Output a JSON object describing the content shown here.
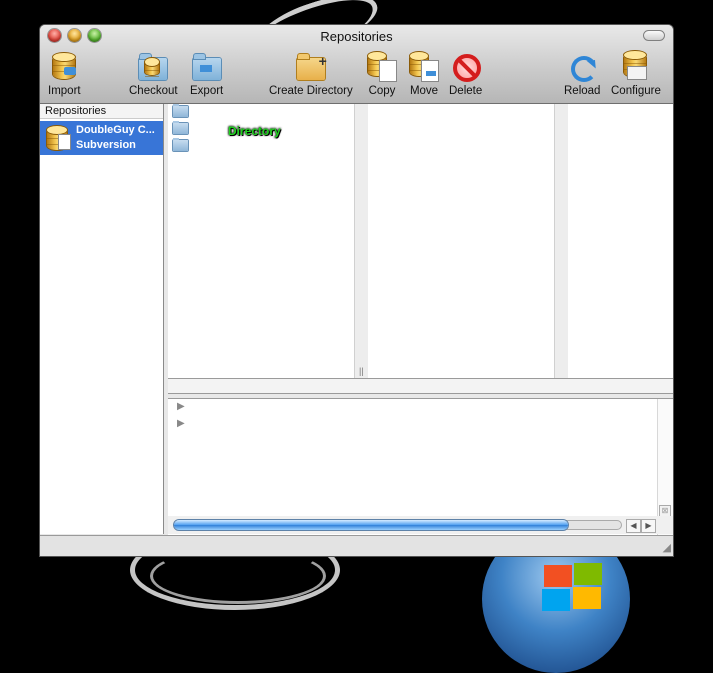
{
  "window": {
    "title": "Repositories"
  },
  "toolbar": {
    "import": "Import",
    "checkout": "Checkout",
    "export": "Export",
    "create_directory": "Create Directory",
    "copy": "Copy",
    "move": "Move",
    "delete": "Delete",
    "reload": "Reload",
    "configure": "Configure"
  },
  "sidebar": {
    "header": "Repositories",
    "items": [
      {
        "name": "DoubleGuy C...",
        "type": "Subversion",
        "selected": true
      }
    ]
  },
  "browser": {
    "rows": 3,
    "drag_label": "Directory"
  },
  "colors": {
    "selection": "#3875d7",
    "drag_label": "#1ed21e",
    "progress": "#4f9ff0"
  },
  "progress": {
    "fraction": 0.88
  }
}
